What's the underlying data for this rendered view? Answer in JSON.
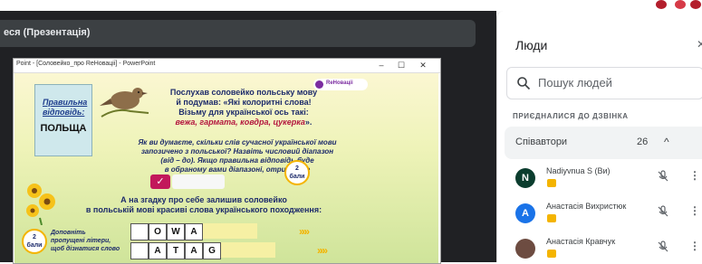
{
  "presentation": {
    "title": "еся (Презентація)"
  },
  "ppt_window": {
    "title": "Point - [Соловейко_про ReНоваціі] - PowerPoint",
    "minimize": "–",
    "maximize": "☐",
    "close": "✕"
  },
  "slide": {
    "answer_label_1": "Правильна",
    "answer_label_2": "відповідь:",
    "answer_value": "ПОЛЬЩА",
    "logo_text": "ReНоваціі",
    "quote_1": "Послухав соловейко польську мову",
    "quote_2": "й подумав: «Які колоритні слова!",
    "quote_3": "Візьму для української ось такі:",
    "quote_words": "вежа, гармата, ковдра, цукерка",
    "quote_end": "».",
    "question_1": "Як ви думаєте, скільки слів сучасної української мови",
    "question_2": "запозичено з польської? Назвіть числовий діапазон",
    "question_3": "(від – до). Якщо правильна відповідь буде",
    "question_4": "в обраному вами діапазоні, отримайте",
    "check": "✓",
    "badge_num": "2",
    "badge_word": "бали",
    "line2_1": "А на згадку про себе залишив соловейко",
    "line2_2": "в польській мові красиві слова українського походження:",
    "hint_1": "Доповніть",
    "hint_2": "пропущені літери,",
    "hint_3": "щоб дізнатися слово",
    "row1": [
      "",
      "O",
      "W",
      "A"
    ],
    "row2": [
      "",
      "A",
      "T",
      "A",
      "G"
    ],
    "arrows": "»»»"
  },
  "people_panel": {
    "title": "Люди",
    "close": "✕",
    "search_placeholder": "Пошук людей",
    "joined_label": "ПРИЄДНАЛИСЯ ДО ДЗВІНКА",
    "group_label": "Співавтори",
    "group_count": "26",
    "chevron": "^",
    "people": [
      {
        "initial": "N",
        "name": "Nadiyvnua S (Ви)",
        "color": "#0b3d2e"
      },
      {
        "initial": "А",
        "name": "Анастасія Вихристюк",
        "color": "#1a73e8"
      },
      {
        "initial": "",
        "name": "Анастасія Кравчук",
        "color": "#6d4c41"
      }
    ]
  },
  "colors": {
    "accent": "#1a73e8",
    "meet_bg": "#202124",
    "badge": "#f4b400"
  }
}
